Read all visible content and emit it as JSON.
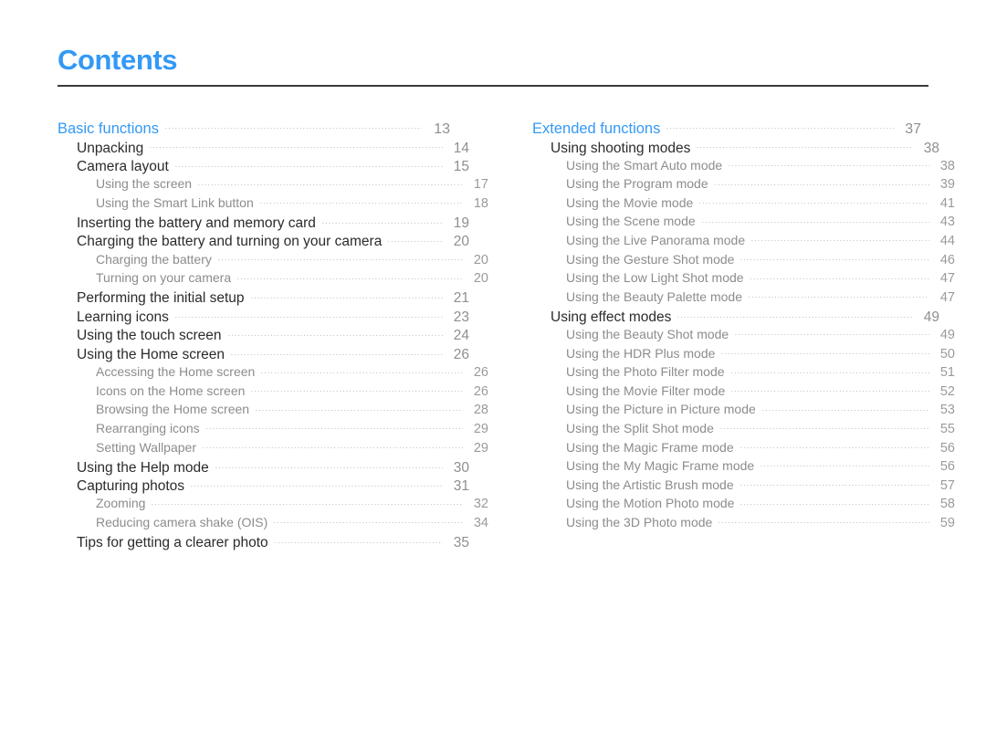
{
  "document": {
    "title": "Contents",
    "title_color": "#3399f5",
    "rule_color": "#3b3b3b",
    "background": "#ffffff"
  },
  "columns": {
    "left": {
      "entries": [
        {
          "level": 1,
          "label": "Basic functions",
          "page": "13"
        },
        {
          "level": 2,
          "label": "Unpacking",
          "page": "14"
        },
        {
          "level": 2,
          "label": "Camera layout",
          "page": "15"
        },
        {
          "level": 3,
          "label": "Using the screen",
          "page": "17"
        },
        {
          "level": 3,
          "label": "Using the Smart Link button",
          "page": "18"
        },
        {
          "level": 2,
          "label": "Inserting the battery and memory card",
          "page": "19"
        },
        {
          "level": 2,
          "label": "Charging the battery and turning on your camera",
          "page": "20"
        },
        {
          "level": 3,
          "label": "Charging the battery",
          "page": "20"
        },
        {
          "level": 3,
          "label": "Turning on your camera",
          "page": "20"
        },
        {
          "level": 2,
          "label": "Performing the initial setup",
          "page": "21"
        },
        {
          "level": 2,
          "label": "Learning icons",
          "page": "23"
        },
        {
          "level": 2,
          "label": "Using the touch screen",
          "page": "24"
        },
        {
          "level": 2,
          "label": "Using the Home screen",
          "page": "26"
        },
        {
          "level": 3,
          "label": "Accessing the Home screen",
          "page": "26"
        },
        {
          "level": 3,
          "label": "Icons on the Home screen",
          "page": "26"
        },
        {
          "level": 3,
          "label": "Browsing the Home screen",
          "page": "28"
        },
        {
          "level": 3,
          "label": "Rearranging icons",
          "page": "29"
        },
        {
          "level": 3,
          "label": "Setting Wallpaper",
          "page": "29"
        },
        {
          "level": 2,
          "label": "Using the Help mode",
          "page": "30"
        },
        {
          "level": 2,
          "label": "Capturing photos",
          "page": "31"
        },
        {
          "level": 3,
          "label": "Zooming",
          "page": "32"
        },
        {
          "level": 3,
          "label": "Reducing camera shake (OIS)",
          "page": "34"
        },
        {
          "level": 2,
          "label": "Tips for getting a clearer photo",
          "page": "35"
        }
      ]
    },
    "right": {
      "entries": [
        {
          "level": 1,
          "label": "Extended functions",
          "page": "37"
        },
        {
          "level": 2,
          "label": "Using shooting modes",
          "page": "38"
        },
        {
          "level": 3,
          "label": "Using the Smart Auto mode",
          "page": "38"
        },
        {
          "level": 3,
          "label": "Using the Program mode",
          "page": "39"
        },
        {
          "level": 3,
          "label": "Using the Movie mode",
          "page": "41"
        },
        {
          "level": 3,
          "label": "Using the Scene mode",
          "page": "43"
        },
        {
          "level": 3,
          "label": "Using the Live Panorama mode",
          "page": "44"
        },
        {
          "level": 3,
          "label": "Using the Gesture Shot mode",
          "page": "46"
        },
        {
          "level": 3,
          "label": "Using the Low Light Shot mode",
          "page": "47"
        },
        {
          "level": 3,
          "label": "Using the Beauty Palette mode",
          "page": "47"
        },
        {
          "level": 2,
          "label": "Using effect modes",
          "page": "49"
        },
        {
          "level": 3,
          "label": "Using the Beauty Shot mode",
          "page": "49"
        },
        {
          "level": 3,
          "label": "Using the HDR Plus mode",
          "page": "50"
        },
        {
          "level": 3,
          "label": "Using the Photo Filter mode",
          "page": "51"
        },
        {
          "level": 3,
          "label": "Using the Movie Filter mode",
          "page": "52"
        },
        {
          "level": 3,
          "label": "Using the Picture in Picture mode",
          "page": "53"
        },
        {
          "level": 3,
          "label": "Using the Split Shot mode",
          "page": "55"
        },
        {
          "level": 3,
          "label": "Using the Magic Frame mode",
          "page": "56"
        },
        {
          "level": 3,
          "label": "Using the My Magic Frame mode",
          "page": "56"
        },
        {
          "level": 3,
          "label": "Using the Artistic Brush mode",
          "page": "57"
        },
        {
          "level": 3,
          "label": "Using the Motion Photo mode",
          "page": "58"
        },
        {
          "level": 3,
          "label": "Using the 3D Photo mode",
          "page": "59"
        }
      ]
    }
  }
}
